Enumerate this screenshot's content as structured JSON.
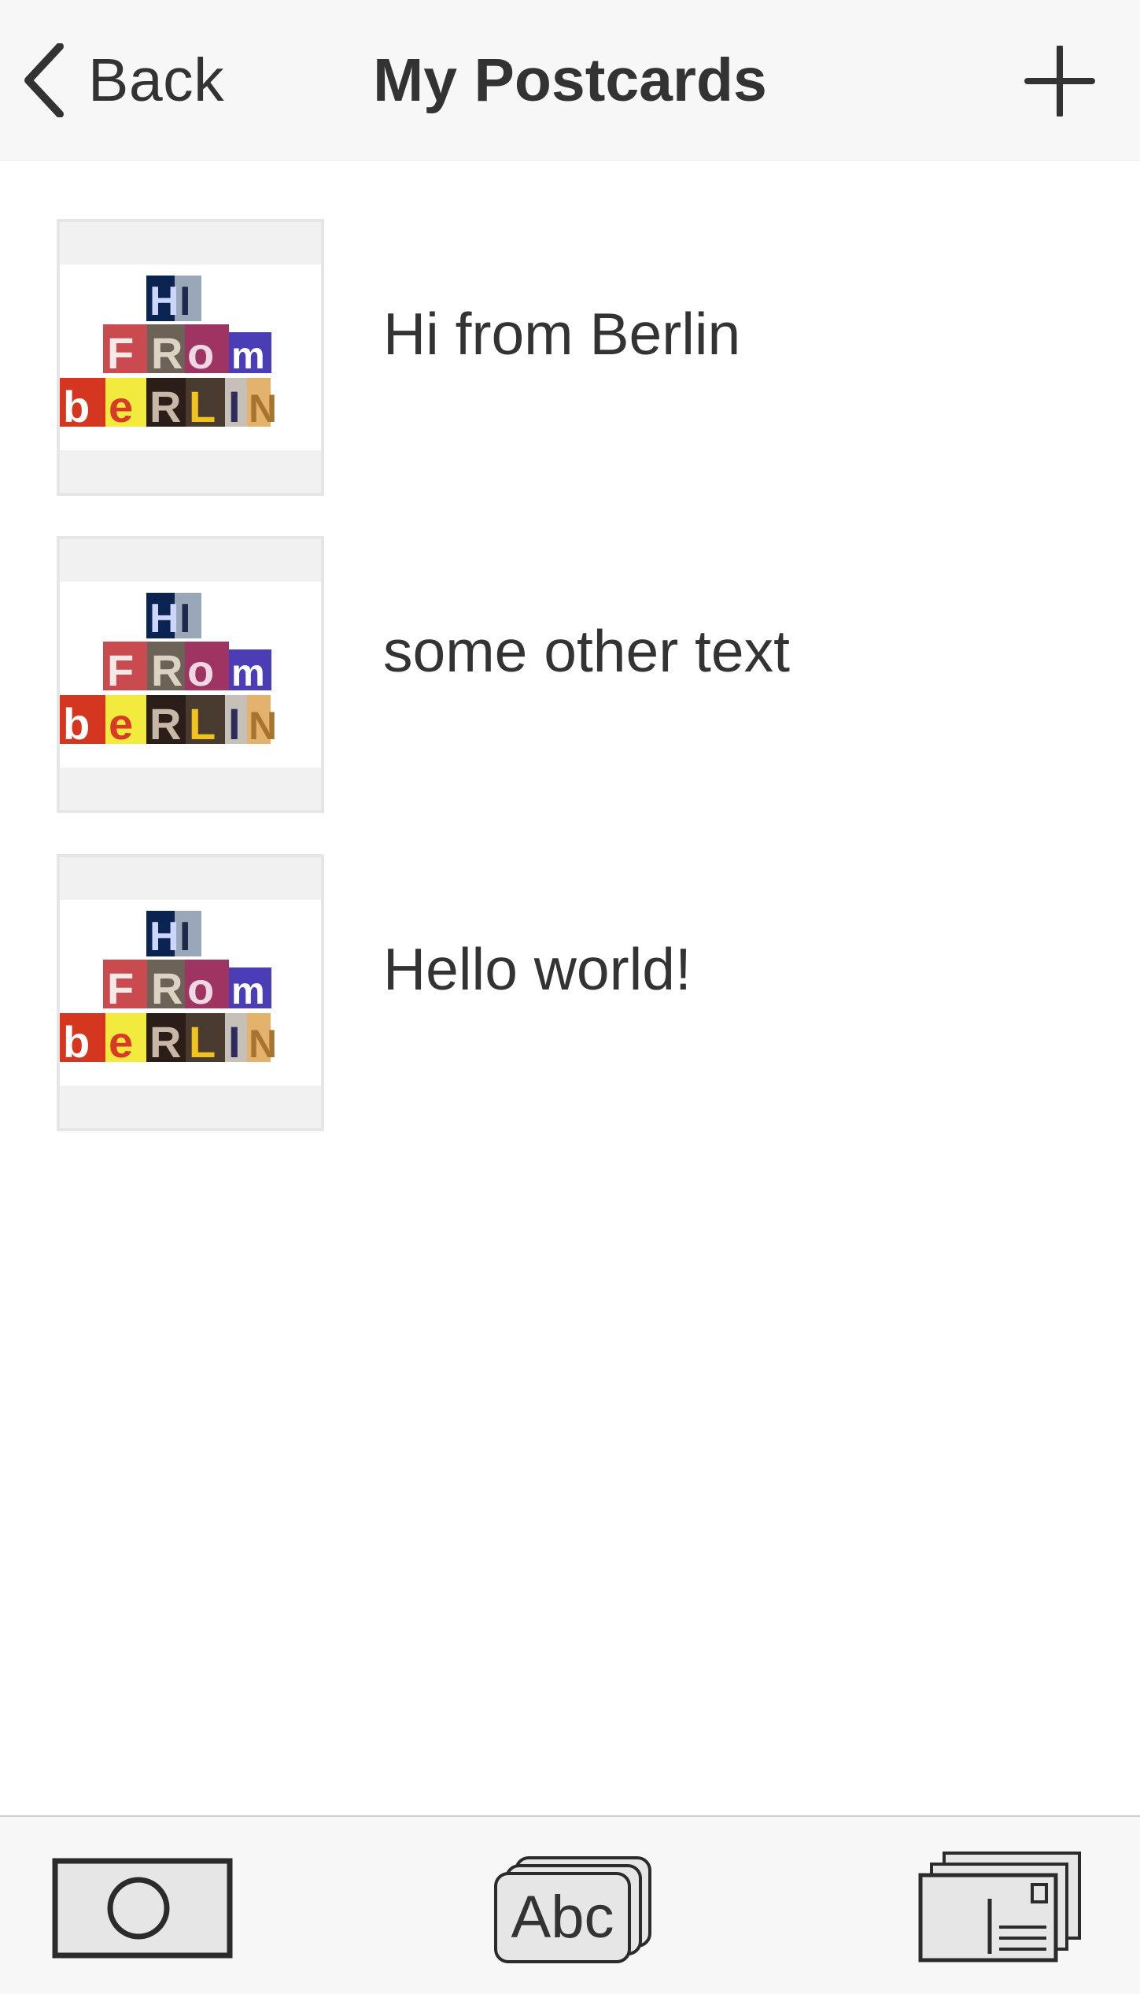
{
  "navbar": {
    "back_label": "Back",
    "title": "My Postcards",
    "back_icon": "chevron-left-icon",
    "add_icon": "plus-icon"
  },
  "postcards": [
    {
      "label": "Hi from Berlin",
      "thumbnail_text": [
        "HI",
        "FROM",
        "BERLIN"
      ]
    },
    {
      "label": "some other text",
      "thumbnail_text": [
        "HI",
        "FROM",
        "BERLIN"
      ]
    },
    {
      "label": "Hello world!",
      "thumbnail_text": [
        "HI",
        "FROM",
        "BERLIN"
      ]
    }
  ],
  "tabbar": {
    "camera_icon": "camera-icon",
    "text_tab_label": "Abc",
    "text_icon": "text-cards-icon",
    "postcards_icon": "postcard-stack-icon"
  },
  "colors": {
    "bar_background": "#f7f7f7",
    "text": "#333333",
    "thumb_frame": "#e6e6e6",
    "thumb_background": "#f1f1f1"
  }
}
